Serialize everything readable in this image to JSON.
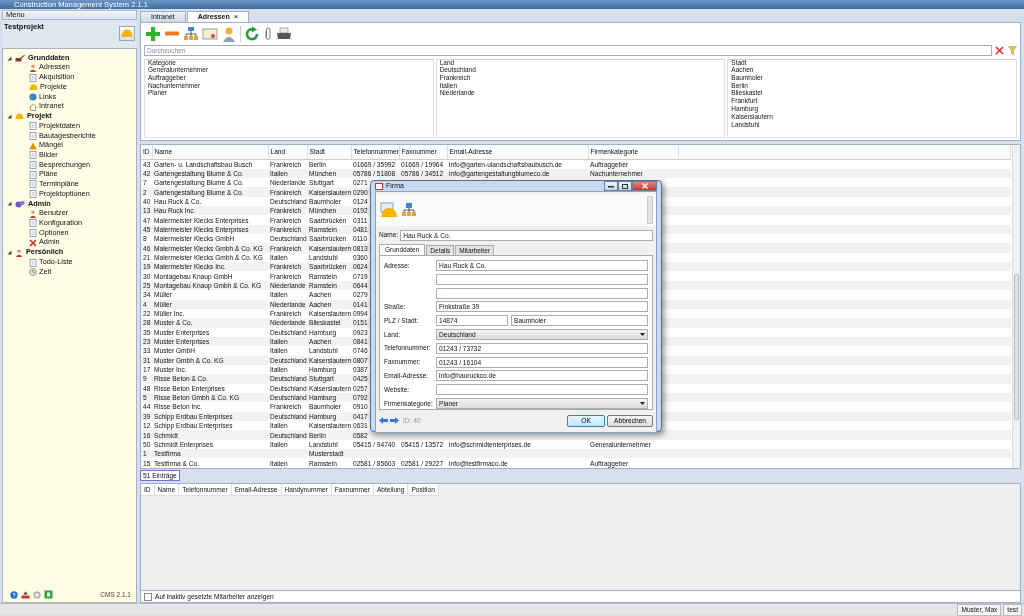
{
  "window": {
    "title": "Construction Management System 2.1.1"
  },
  "menu": {
    "title": "Menu",
    "project": "Testprojekt",
    "version": "CMS 2.1.1",
    "tree": [
      {
        "label": "Grunddaten",
        "expanded": true,
        "children": [
          {
            "label": "Adressen"
          },
          {
            "label": "Akquisition"
          },
          {
            "label": "Projekte"
          },
          {
            "label": "Links"
          },
          {
            "label": "Intranet"
          }
        ]
      },
      {
        "label": "Projekt",
        "expanded": true,
        "children": [
          {
            "label": "Projektdaten"
          },
          {
            "label": "Bautagesberichte"
          },
          {
            "label": "Mängel"
          },
          {
            "label": "Bilder"
          },
          {
            "label": "Besprechungen"
          },
          {
            "label": "Pläne"
          },
          {
            "label": "Terminpläne"
          },
          {
            "label": "Projektoptionen"
          }
        ]
      },
      {
        "label": "Admin",
        "expanded": true,
        "children": [
          {
            "label": "Benutzer"
          },
          {
            "label": "Konfiguration"
          },
          {
            "label": "Optionen"
          },
          {
            "label": "Admin"
          }
        ]
      },
      {
        "label": "Persönlich",
        "expanded": true,
        "children": [
          {
            "label": "Todo-Liste"
          },
          {
            "label": "Zeit"
          }
        ]
      }
    ]
  },
  "tabs": [
    {
      "label": "Intranet",
      "selected": false,
      "closable": false
    },
    {
      "label": "Adressen",
      "selected": true,
      "closable": true,
      "close": "×"
    }
  ],
  "search": {
    "placeholder": "Durchsuchen"
  },
  "filters": [
    {
      "title": "Kategorie",
      "items": [
        "Generalunternehmer",
        "Auftraggeber",
        "Nachunternehmer",
        "Planer"
      ]
    },
    {
      "title": "Land",
      "items": [
        "Deutschland",
        "Frankreich",
        "Italien",
        "Niederlande"
      ]
    },
    {
      "title": "Stadt",
      "items": [
        "Aachen",
        "Baumholer",
        "Berlin",
        "Blieskastel",
        "Frankfurt",
        "Hamburg",
        "Kaiserslautern",
        "Landstuhl"
      ]
    }
  ],
  "table": {
    "columns": [
      "ID",
      "Name",
      "Land",
      "Stadt",
      "Telefonnummer",
      "Faxnummer",
      "Email-Adresse",
      "Firmenkategorie"
    ],
    "rows": [
      {
        "id": "43",
        "name": "Garten- u. Landschaftsbau Busch",
        "land": "Frankreich",
        "stadt": "Berlin",
        "phone": "01669 / 35992",
        "fax": "01669 / 19964",
        "email": "info@garten-ulandschaftsbaubusch.de",
        "category": "Auftraggeber"
      },
      {
        "id": "42",
        "name": "Gartengestaltung Blume & Co.",
        "land": "Italien",
        "stadt": "München",
        "phone": "05786 / 51808",
        "fax": "05786 / 34512",
        "email": "info@gartengestaltungblumeco.de",
        "category": "Nachunternehmer"
      },
      {
        "id": "7",
        "name": "Gartengestaltung Blume & Co.",
        "land": "Niederlande",
        "stadt": "Stuttgart",
        "phone": "0271"
      },
      {
        "id": "2",
        "name": "Gartengestaltung Blume & Co.",
        "land": "Frankreich",
        "stadt": "Kaiserslautern",
        "phone": "0290"
      },
      {
        "id": "40",
        "name": "Hau Ruck & Co.",
        "land": "Deutschland",
        "stadt": "Baumholer",
        "phone": "0124"
      },
      {
        "id": "13",
        "name": "Hau Ruck Inc.",
        "land": "Frankreich",
        "stadt": "München",
        "phone": "0192"
      },
      {
        "id": "47",
        "name": "Malermeister Klecks Enterprises",
        "land": "Frankreich",
        "stadt": "Saarbrücken",
        "phone": "0311"
      },
      {
        "id": "45",
        "name": "Malermeister Klecks Enterprises",
        "land": "Frankreich",
        "stadt": "Ramstein",
        "phone": "0481"
      },
      {
        "id": "8",
        "name": "Malermeister Klecks GmbH",
        "land": "Deutschland",
        "stadt": "Saarbrücken",
        "phone": "0110"
      },
      {
        "id": "46",
        "name": "Malermeister Klecks Gmbh & Co. KG",
        "land": "Frankreich",
        "stadt": "Kaiserslautern",
        "phone": "0813"
      },
      {
        "id": "21",
        "name": "Malermeister Klecks Gmbh & Co. KG",
        "land": "Italien",
        "stadt": "Landstuhl",
        "phone": "0360"
      },
      {
        "id": "19",
        "name": "Malermeister Klecks Inc.",
        "land": "Frankreich",
        "stadt": "Saarbrücken",
        "phone": "0624"
      },
      {
        "id": "30",
        "name": "Montagebau Knaup GmbH",
        "land": "Frankreich",
        "stadt": "Ramstein",
        "phone": "0719"
      },
      {
        "id": "25",
        "name": "Montagebau Knaup Gmbh & Co. KG",
        "land": "Niederlande",
        "stadt": "Ramstein",
        "phone": "0644"
      },
      {
        "id": "34",
        "name": "Müller",
        "land": "Italien",
        "stadt": "Aachen",
        "phone": "0279"
      },
      {
        "id": "4",
        "name": "Müller",
        "land": "Niederlande",
        "stadt": "Aachen",
        "phone": "0141"
      },
      {
        "id": "22",
        "name": "Müller Inc.",
        "land": "Frankreich",
        "stadt": "Kaiserslautern",
        "phone": "0994"
      },
      {
        "id": "28",
        "name": "Muster & Co.",
        "land": "Niederlande",
        "stadt": "Blieskastel",
        "phone": "0151"
      },
      {
        "id": "35",
        "name": "Muster Enterprises",
        "land": "Deutschland",
        "stadt": "Hamburg",
        "phone": "0923"
      },
      {
        "id": "23",
        "name": "Muster Enterprises",
        "land": "Italien",
        "stadt": "Aachen",
        "phone": "0841"
      },
      {
        "id": "33",
        "name": "Muster GmbH",
        "land": "Italien",
        "stadt": "Landstuhl",
        "phone": "0746"
      },
      {
        "id": "31",
        "name": "Muster Gmbh & Co. KG",
        "land": "Deutschland",
        "stadt": "Kaiserslautern",
        "phone": "0807"
      },
      {
        "id": "17",
        "name": "Muster Inc.",
        "land": "Italien",
        "stadt": "Hamburg",
        "phone": "0387"
      },
      {
        "id": "9",
        "name": "Risse Beton & Co.",
        "land": "Deutschland",
        "stadt": "Stuttgart",
        "phone": "0425"
      },
      {
        "id": "48",
        "name": "Risse Beton Enterprises",
        "land": "Deutschland",
        "stadt": "Kaiserslautern",
        "phone": "0257"
      },
      {
        "id": "5",
        "name": "Risse Beton Gmbh & Co. KG",
        "land": "Deutschland",
        "stadt": "Hamburg",
        "phone": "0792"
      },
      {
        "id": "44",
        "name": "Risse Beton Inc.",
        "land": "Frankreich",
        "stadt": "Baumholer",
        "phone": "0910"
      },
      {
        "id": "39",
        "name": "Schipp Erdbau Enterprises",
        "land": "Deutschland",
        "stadt": "Hamburg",
        "phone": "0417"
      },
      {
        "id": "12",
        "name": "Schipp Erdbau Enterprises",
        "land": "Italien",
        "stadt": "Kaiserslautern",
        "phone": "0631"
      },
      {
        "id": "16",
        "name": "Schmidt",
        "land": "Deutschland",
        "stadt": "Berlin",
        "phone": "0582"
      },
      {
        "id": "50",
        "name": "Schmidt Enterprises",
        "land": "Italien",
        "stadt": "Landstuhl",
        "phone": "05415 / 94740",
        "fax": "05415 / 13572",
        "email": "info@schmidtenterprises.de",
        "category": "Generalunternehmer"
      },
      {
        "id": "1",
        "name": "Testfirma",
        "stadt": "Musterstadt"
      },
      {
        "id": "15",
        "name": "Testfirma & Co.",
        "land": "Italien",
        "stadt": "Ramstein",
        "phone": "02581 / 85603",
        "fax": "02581 / 29227",
        "email": "info@testfirmaco.de",
        "category": "Auftraggeber"
      }
    ]
  },
  "count": "51 Einträge",
  "staff_table": {
    "columns": [
      "ID",
      "Name",
      "Telefonnummer",
      "Email-Adresse",
      "Handynummer",
      "Faxnummer",
      "Abteilung",
      "Position"
    ]
  },
  "show_inactive": {
    "label": "Auf inaktiv gesetzte Mitarbeiter anzeigen",
    "checked": false
  },
  "dialog": {
    "title": "Firma",
    "name_label": "Name:",
    "name": "Hau Ruck & Co.",
    "tabs": [
      {
        "label": "Grunddaten",
        "selected": true
      },
      {
        "label": "Details",
        "selected": false
      },
      {
        "label": "Mitarbeiter",
        "selected": false
      }
    ],
    "fields": [
      {
        "kind": "text",
        "label": "Adresse:",
        "value": "Hau Ruck & Co."
      },
      {
        "kind": "text"
      },
      {
        "kind": "text"
      },
      {
        "kind": "text",
        "label": "Straße:",
        "value": "Finkstraße 39"
      },
      {
        "kind": "pair",
        "label": "PLZ / Stadt:",
        "value": "14874",
        "value2": "Baumholer"
      },
      {
        "kind": "select",
        "label": "Land:",
        "value": "Deutschland"
      },
      {
        "kind": "text",
        "label": "Telefonnummer:",
        "value": "01243 / 73732"
      },
      {
        "kind": "text",
        "label": "Faxnummer:",
        "value": "01243 / 16104"
      },
      {
        "kind": "text",
        "label": "Email-Adresse:",
        "value": "info@hauruckco.de"
      },
      {
        "kind": "text",
        "label": "Website:"
      },
      {
        "kind": "select",
        "label": "Firmenkategorie:",
        "value": "Planer"
      }
    ],
    "id_label": "ID: 40",
    "ok": "OK",
    "cancel": "Abbrechen"
  },
  "status_bar": {
    "user": "Muster, Max",
    "db": "test"
  }
}
